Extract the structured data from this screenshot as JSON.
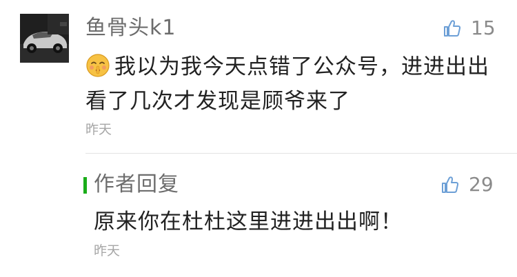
{
  "comment": {
    "author": "鱼骨头k1",
    "avatar_icon": "sports-car-avatar",
    "emoji_icon": "shushing-face-emoji",
    "text": "我以为我今天点错了公众号，进进出出看了几次才发现是顾爷来了",
    "time": "昨天",
    "likes": "15"
  },
  "reply": {
    "label": "作者回复",
    "accent_color": "#1aad19",
    "text": "原来你在杜杜这里进进出出啊！",
    "time": "昨天",
    "likes": "29"
  }
}
